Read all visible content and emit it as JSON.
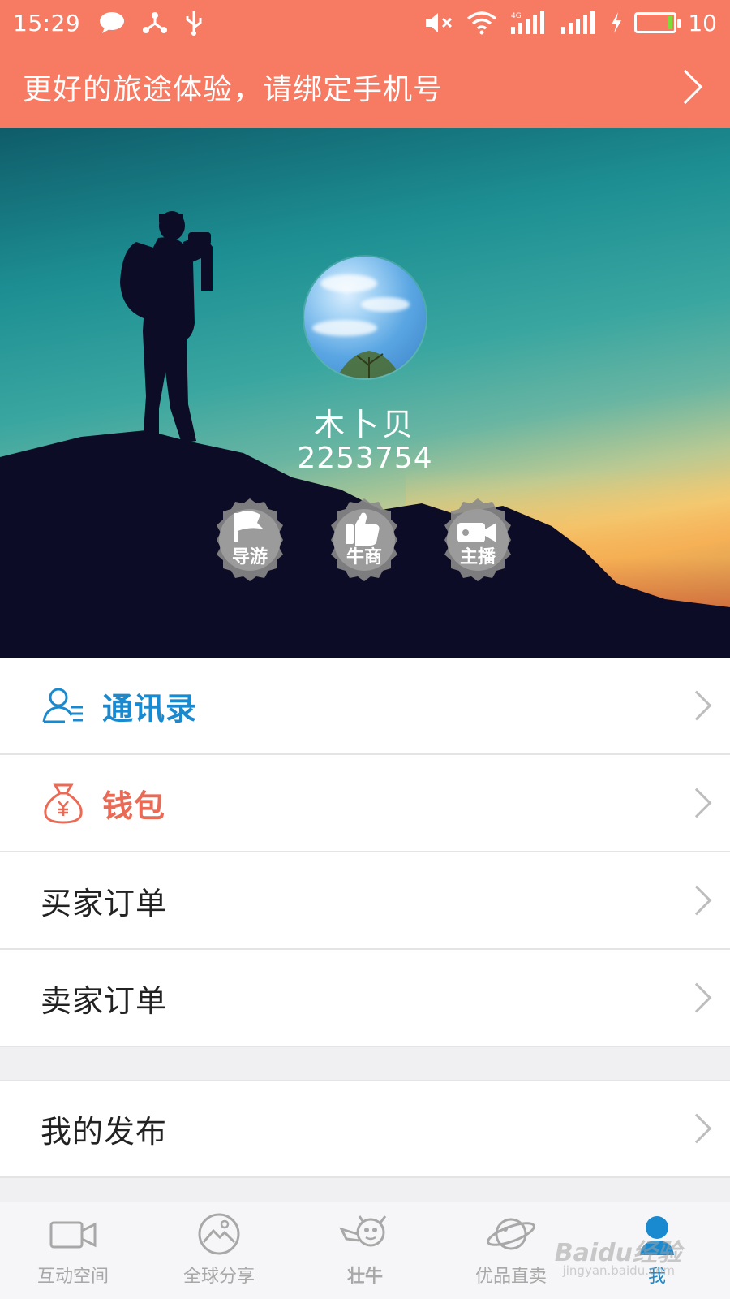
{
  "status_bar": {
    "time": "15:29",
    "network_label": "4G",
    "battery_level": "10"
  },
  "banner": {
    "text": "更好的旅途体验，请绑定手机号"
  },
  "profile": {
    "name": "木卜贝",
    "user_id": "2253754",
    "badges": [
      {
        "label": "导游",
        "icon": "flag-icon"
      },
      {
        "label": "牛商",
        "icon": "thumbs-up-icon"
      },
      {
        "label": "主播",
        "icon": "video-camera-icon"
      }
    ]
  },
  "menu": {
    "contacts": "通讯录",
    "wallet": "钱包",
    "buyer_orders": "买家订单",
    "seller_orders": "卖家订单",
    "my_posts": "我的发布"
  },
  "tabs": [
    {
      "label": "互动空间",
      "icon": "video-camera-icon"
    },
    {
      "label": "全球分享",
      "icon": "image-icon"
    },
    {
      "label": "壮牛",
      "icon": "mascot-icon"
    },
    {
      "label": "优品直卖",
      "icon": "planet-icon"
    },
    {
      "label": "我",
      "icon": "user-icon",
      "active": true
    }
  ],
  "watermark": {
    "text": "Baidu经验",
    "sub": "jingyan.baidu.com"
  },
  "colors": {
    "brand": "#f77a63",
    "accent_blue": "#1a8ad0",
    "wallet_red": "#ea6a55"
  }
}
